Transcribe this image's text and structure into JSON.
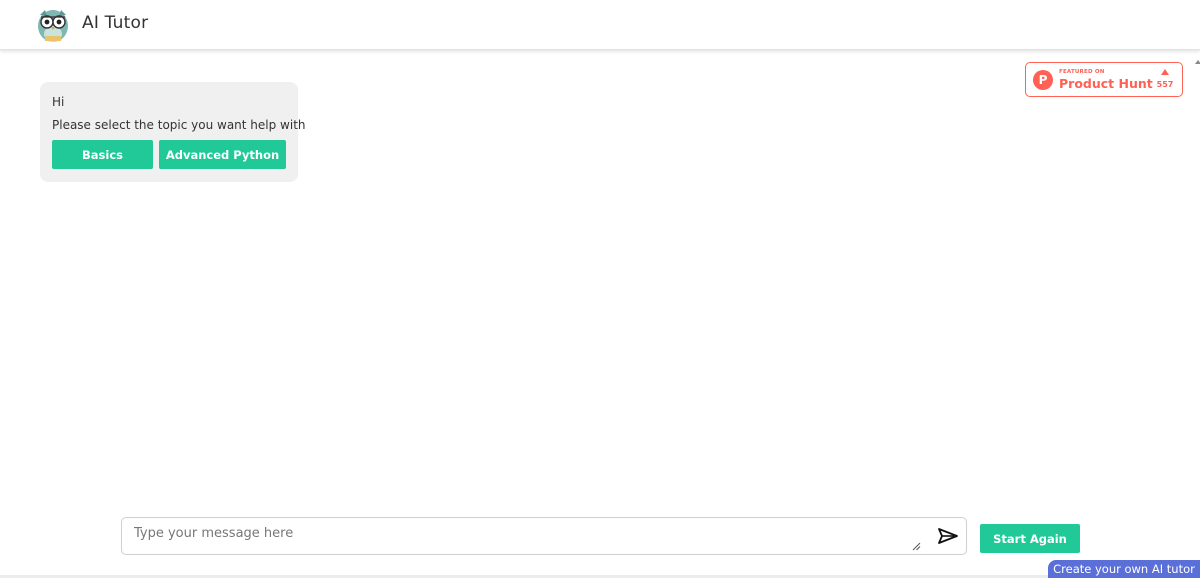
{
  "header": {
    "app_title": "AI Tutor",
    "logo_icon": "owl-icon"
  },
  "product_hunt": {
    "featured_label": "FEATURED ON",
    "name": "Product Hunt",
    "upvotes": "557",
    "color": "#ff6154"
  },
  "chat": {
    "messages": [
      {
        "text": "Hi"
      },
      {
        "text": "Please select the topic you want help with"
      }
    ],
    "topic_buttons": [
      {
        "label": "Basics"
      },
      {
        "label": "Advanced Python"
      }
    ]
  },
  "composer": {
    "placeholder": "Type your message here",
    "value": "",
    "send_icon": "send-icon",
    "start_again_label": "Start Again"
  },
  "footer": {
    "create_tutor_label": "Create your own AI tutor"
  },
  "colors": {
    "accent": "#20c997",
    "footer_badge": "#5b6fd8",
    "bubble_bg": "#f0f0f0"
  }
}
